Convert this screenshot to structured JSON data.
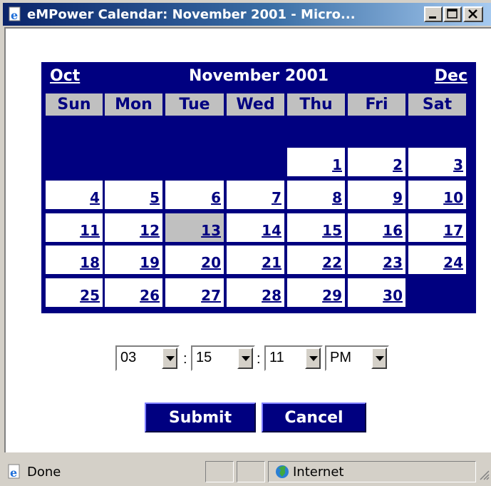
{
  "window": {
    "title": "eMPower Calendar: November 2001 - Micro..."
  },
  "calendar": {
    "prev_month": "Oct",
    "month_year": "November 2001",
    "next_month": "Dec",
    "weekdays": [
      "Sun",
      "Mon",
      "Tue",
      "Wed",
      "Thu",
      "Fri",
      "Sat"
    ],
    "weeks": [
      [
        "",
        "",
        "",
        "",
        "1",
        "2",
        "3"
      ],
      [
        "4",
        "5",
        "6",
        "7",
        "8",
        "9",
        "10"
      ],
      [
        "11",
        "12",
        "13",
        "14",
        "15",
        "16",
        "17"
      ],
      [
        "18",
        "19",
        "20",
        "21",
        "22",
        "23",
        "24"
      ],
      [
        "25",
        "26",
        "27",
        "28",
        "29",
        "30",
        ""
      ]
    ],
    "selected_day": "13",
    "colors": {
      "header_bg": "#000080",
      "weekday_bg": "#c0c0c0",
      "selected_bg": "#c0c0c0"
    }
  },
  "time": {
    "hour": "03",
    "separator_1": ":",
    "minute": "15",
    "separator_2": ":",
    "second": "11",
    "ampm": "PM"
  },
  "buttons": {
    "submit": "Submit",
    "cancel": "Cancel"
  },
  "status": {
    "text": "Done",
    "zone": "Internet"
  },
  "icons": [
    "ie-page-icon",
    "minimize-icon",
    "maximize-icon",
    "close-icon",
    "ie-done-icon",
    "internet-globe-icon",
    "resize-grip-icon"
  ]
}
